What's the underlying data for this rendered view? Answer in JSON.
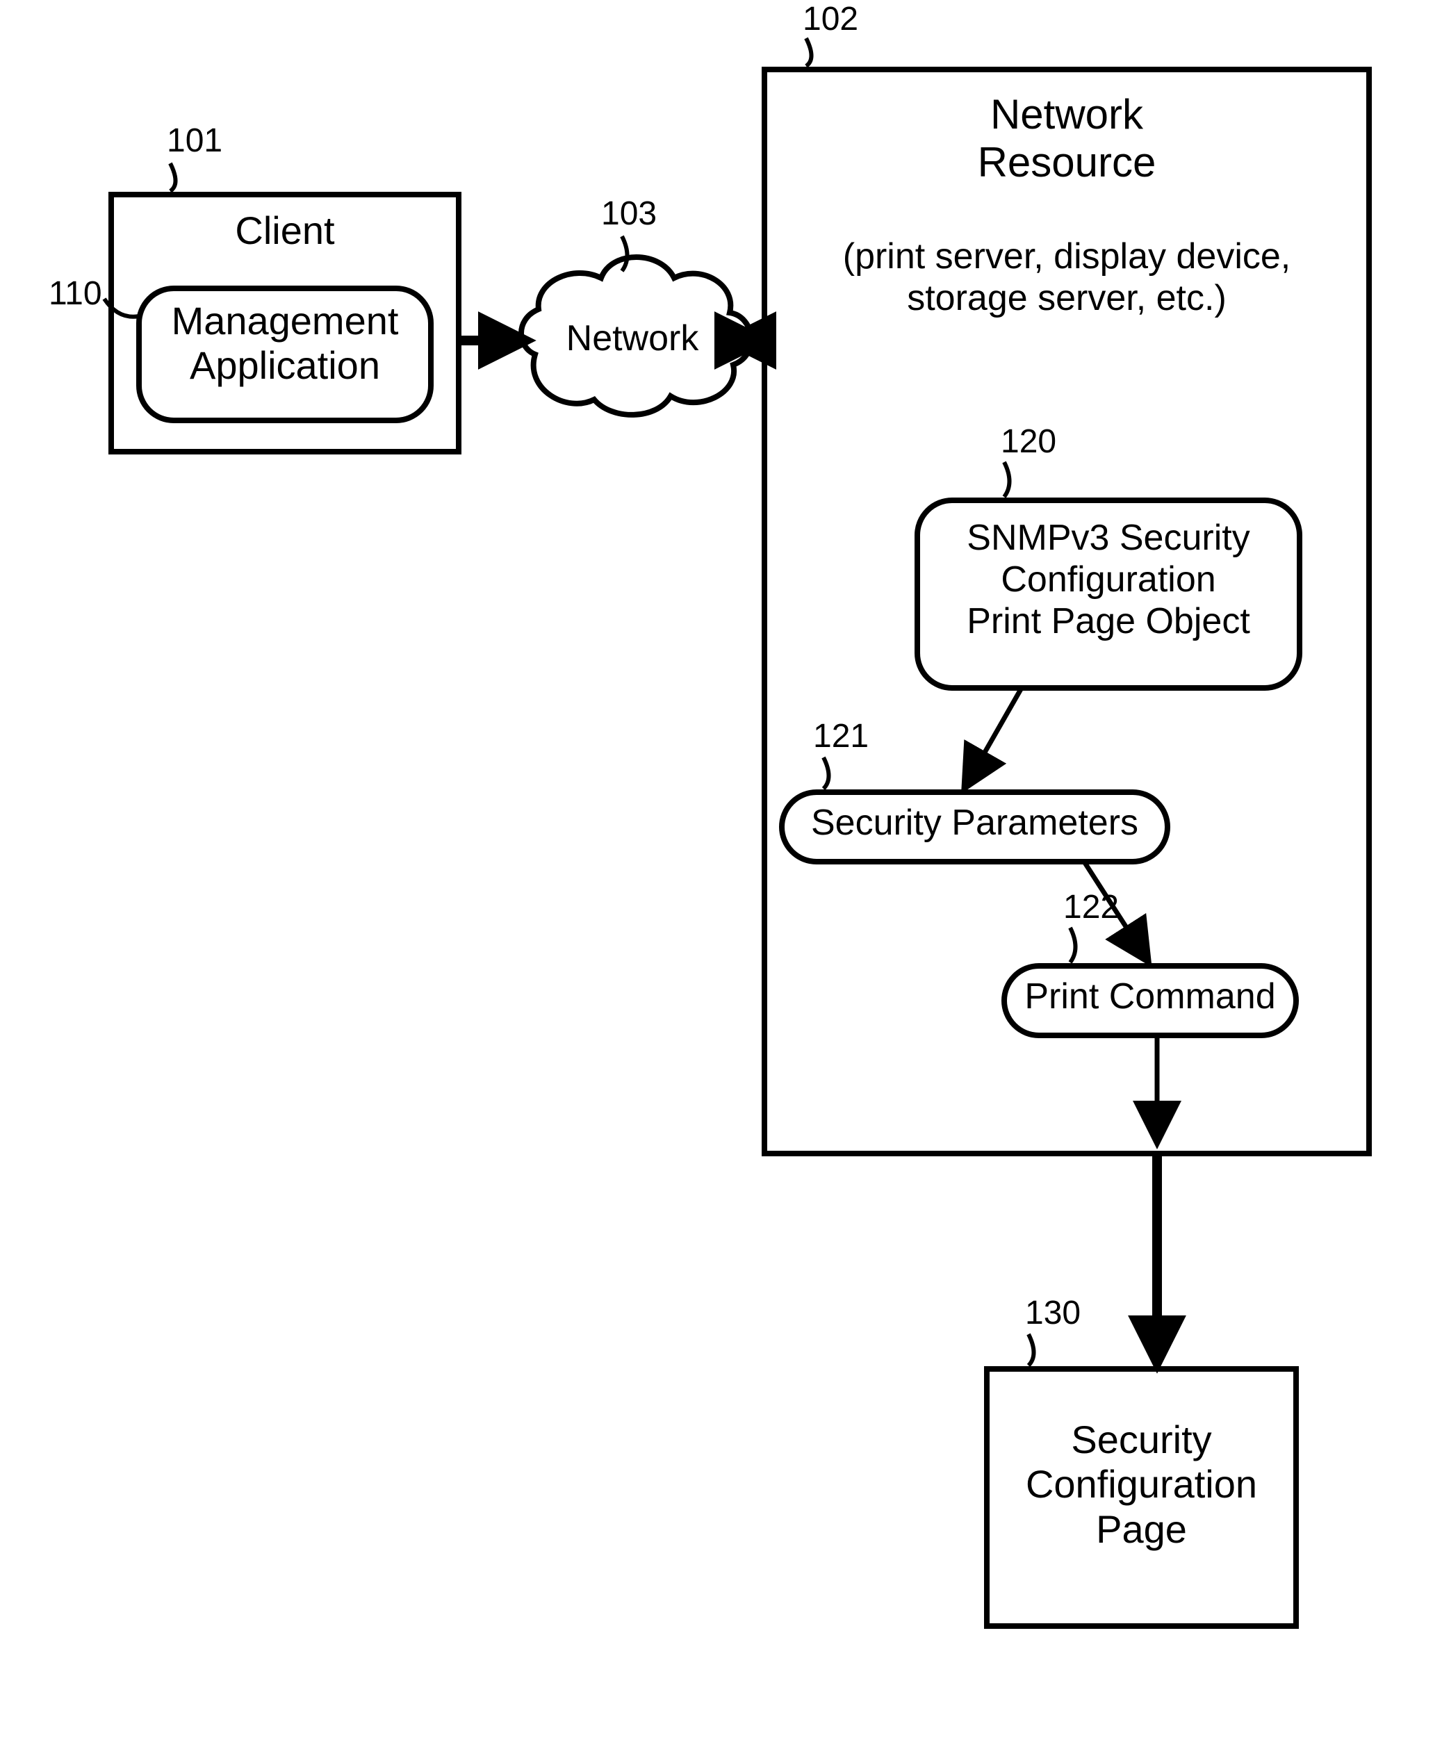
{
  "refs": {
    "client": "101",
    "resource": "102",
    "network": "103",
    "mgmt": "110",
    "snmp": "120",
    "secparams": "121",
    "printcmd": "122",
    "secpage": "130"
  },
  "nodes": {
    "client_title": "Client",
    "mgmt_line1": "Management",
    "mgmt_line2": "Application",
    "network_label": "Network",
    "resource_title_line1": "Network",
    "resource_title_line2": "Resource",
    "resource_sub_line1": "(print server, display device,",
    "resource_sub_line2": "storage server, etc.)",
    "snmp_line1": "SNMPv3 Security",
    "snmp_line2": "Configuration",
    "snmp_line3": "Print Page Object",
    "secparams_label": "Security Parameters",
    "printcmd_label": "Print Command",
    "secpage_line1": "Security",
    "secpage_line2": "Configuration",
    "secpage_line3": "Page"
  }
}
